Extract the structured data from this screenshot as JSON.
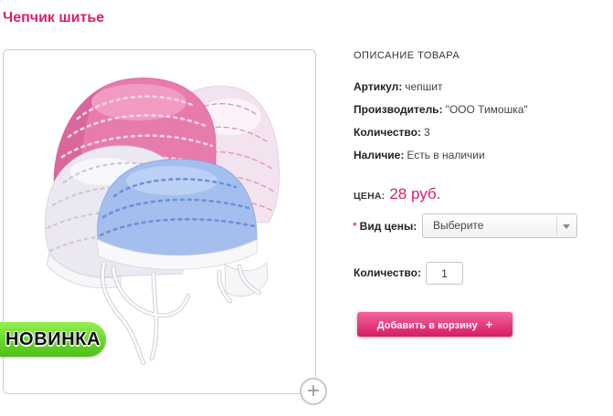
{
  "product": {
    "title": "Чепчик шитье",
    "badge": "НОВИНКА"
  },
  "image_zoom": {
    "icon": "zoom-plus-icon",
    "glyph": "+"
  },
  "description": {
    "heading": "ОПИСАНИЕ ТОВАРА",
    "fields": [
      {
        "label": "Артикул:",
        "value": "чепшит"
      },
      {
        "label": "Производитель:",
        "value": "\"ООО Тимошка\""
      },
      {
        "label": "Количество:",
        "value": "3"
      },
      {
        "label": "Наличие:",
        "value": "Есть в наличии"
      }
    ]
  },
  "price": {
    "label": "ЦЕНА:",
    "value": "28 руб."
  },
  "price_type": {
    "required_mark": "*",
    "label": "Вид цены:",
    "selected": "Выберите",
    "icon": "chevron-down-icon"
  },
  "quantity": {
    "label": "Количество:",
    "value": "1"
  },
  "cart_button": {
    "label": "Добавить в корзину",
    "glyph": "+",
    "icon": "plus-icon"
  },
  "colors": {
    "accent": "#d8226d",
    "badge_green": "#6fdd2c",
    "required_mark": "#e8001c",
    "button_top": "#f3659b",
    "button_bottom": "#d81a66"
  }
}
